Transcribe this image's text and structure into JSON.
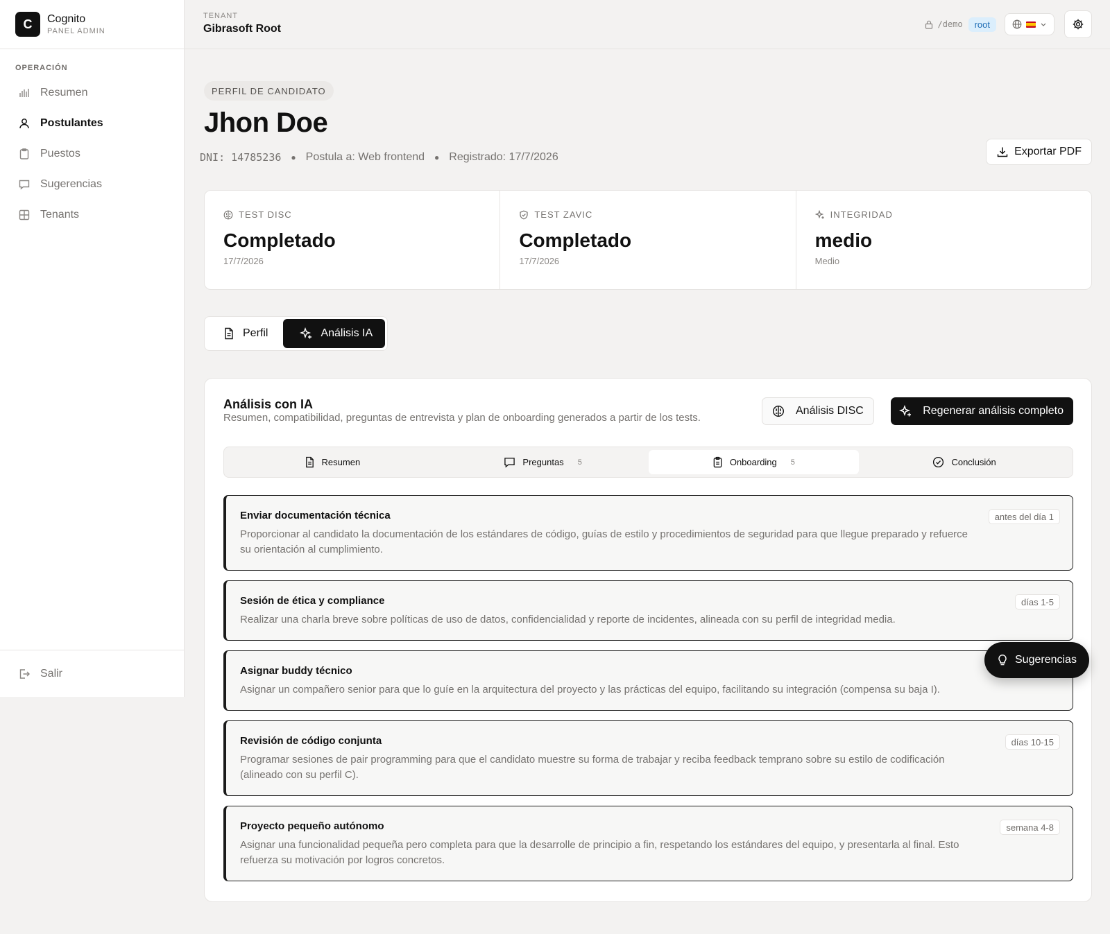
{
  "brand": {
    "logo_letter": "C",
    "name": "Cognito",
    "subtitle": "PANEL ADMIN"
  },
  "sidebar": {
    "section_label": "OPERACIÓN",
    "items": [
      {
        "label": "Resumen",
        "icon": "bar-chart-icon",
        "active": false
      },
      {
        "label": "Postulantes",
        "icon": "user-icon",
        "active": true
      },
      {
        "label": "Puestos",
        "icon": "clipboard-icon",
        "active": false
      },
      {
        "label": "Sugerencias",
        "icon": "message-icon",
        "active": false
      },
      {
        "label": "Tenants",
        "icon": "grid-icon",
        "active": false
      }
    ],
    "logout_label": "Salir"
  },
  "topbar": {
    "tenant_label": "TENANT",
    "tenant_name": "Gibrasoft Root",
    "path": "/demo",
    "role": "root"
  },
  "profile": {
    "section_pill": "PERFIL DE CANDIDATO",
    "name": "Jhon Doe",
    "dni": "DNI: 14785236",
    "applies": "Postula a: Web frontend",
    "registered": "Registrado: 17/7/2026",
    "export_label": "Exportar PDF"
  },
  "stats": [
    {
      "label": "TEST DISC",
      "icon": "brain-icon",
      "value": "Completado",
      "sub": "17/7/2026"
    },
    {
      "label": "TEST ZAVIC",
      "icon": "shield-icon",
      "value": "Completado",
      "sub": "17/7/2026"
    },
    {
      "label": "INTEGRIDAD",
      "icon": "sparkles-icon",
      "value": "medio",
      "sub": "Medio"
    }
  ],
  "view_tabs": [
    {
      "label": "Perfil",
      "active": false
    },
    {
      "label": "Análisis IA",
      "active": true
    }
  ],
  "panel": {
    "title": "Análisis con IA",
    "description": "Resumen, compatibilidad, preguntas de entrevista y plan de onboarding generados a partir de los tests.",
    "disc_button": "Análisis DISC",
    "regen_button": "Regenerar análisis completo",
    "tabs": [
      {
        "label": "Resumen",
        "count": "",
        "active": false
      },
      {
        "label": "Preguntas",
        "count": "5",
        "active": false
      },
      {
        "label": "Onboarding",
        "count": "5",
        "active": true
      },
      {
        "label": "Conclusión",
        "count": "",
        "active": false
      }
    ],
    "cards": [
      {
        "title": "Enviar documentación técnica",
        "body": "Proporcionar al candidato la documentación de los estándares de código, guías de estilo y procedimientos de seguridad para que llegue preparado y refuerce su orientación al cumplimiento.",
        "badge": "antes del día 1"
      },
      {
        "title": "Sesión de ética y compliance",
        "body": "Realizar una charla breve sobre políticas de uso de datos, confidencialidad y reporte de incidentes, alineada con su perfil de integridad media.",
        "badge": "días 1-5"
      },
      {
        "title": "Asignar buddy técnico",
        "body": "Asignar un compañero senior para que lo guíe en la arquitectura del proyecto y las prácticas del equipo, facilitando su integración (compensa su baja I).",
        "badge": ""
      },
      {
        "title": "Revisión de código conjunta",
        "body": "Programar sesiones de pair programming para que el candidato muestre su forma de trabajar y reciba feedback temprano sobre su estilo de codificación (alineado con su perfil C).",
        "badge": "días 10-15"
      },
      {
        "title": "Proyecto pequeño autónomo",
        "body": "Asignar una funcionalidad pequeña pero completa para que la desarrolle de principio a fin, respetando los estándares del equipo, y presentarla al final. Esto refuerza su motivación por logros concretos.",
        "badge": "semana 4-8"
      }
    ]
  },
  "fab": {
    "label": "Sugerencias",
    "icon": "lightbulb-icon"
  }
}
